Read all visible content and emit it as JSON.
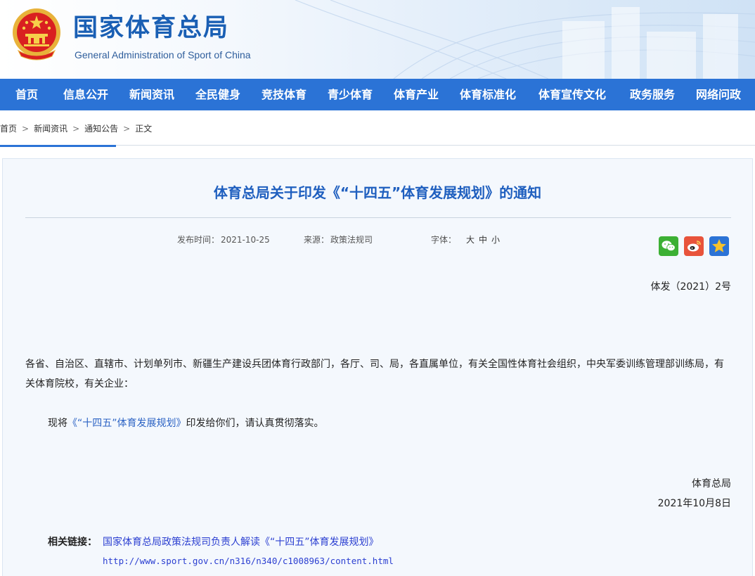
{
  "header": {
    "site_name_cn": "国家体育总局",
    "site_name_en": "General Administration of Sport of China",
    "emblem_icon": "national-emblem-icon"
  },
  "nav": {
    "items": [
      "首页",
      "信息公开",
      "新闻资讯",
      "全民健身",
      "竞技体育",
      "青少体育",
      "体育产业",
      "体育标准化",
      "体育宣传文化",
      "政务服务",
      "网络问政"
    ],
    "bg_color": "#2b73d6"
  },
  "breadcrumb": {
    "items": [
      "首页",
      "新闻资讯",
      "通知公告",
      "正文"
    ],
    "separator": ">"
  },
  "article": {
    "title": "体育总局关于印发《“十四五”体育发展规划》的通知",
    "meta": {
      "date_label": "发布时间：",
      "date": "2021-10-25",
      "source_label": "来源：",
      "source": "政策法规司",
      "font_label": "字体：",
      "font_sizes": [
        "大",
        "中",
        "小"
      ]
    },
    "share_icons": [
      "wechat-icon",
      "weibo-icon",
      "favorite-icon"
    ],
    "doc_number": "体发（2021）2号",
    "recipients": "各省、自治区、直辖市、计划单列市、新疆生产建设兵团体育行政部门，各厅、司、局，各直属单位，有关全国性体育社会组织，中央军委训练管理部训练局，有关体育院校，有关企业：",
    "body_prefix": "现将",
    "body_link": "《“十四五”体育发展规划》",
    "body_suffix": "印发给你们，请认真贯彻落实。",
    "signature": "体育总局",
    "signature_date": "2021年10月8日",
    "related_label": "相关链接：",
    "related_title": "国家体育总局政策法规司负责人解读《“十四五”体育发展规划》",
    "related_url": "http://www.sport.gov.cn/n316/n340/c1008963/content.html"
  },
  "colors": {
    "title": "#1f5fbf",
    "link": "#2b62c4",
    "related_link": "#2b3fd1",
    "panel_bg": "#f4f8fd"
  }
}
